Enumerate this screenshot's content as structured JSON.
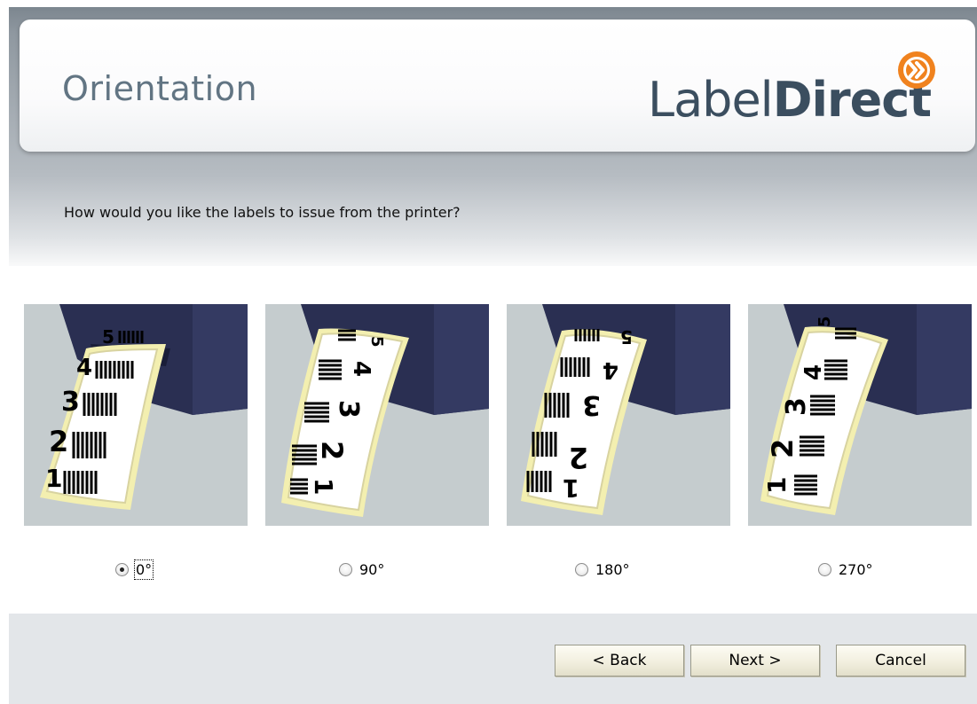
{
  "header": {
    "title": "Orientation",
    "logo": {
      "light": "Label",
      "bold": "Direct",
      "badge_icon": "double-chevron-right-icon"
    }
  },
  "question": "How would you like the labels to issue from the printer?",
  "options": [
    {
      "label": "0°",
      "selected": true,
      "labels_shown": [
        "5",
        "4",
        "3",
        "2",
        "1"
      ]
    },
    {
      "label": "90°",
      "selected": false,
      "labels_shown": [
        "5",
        "4",
        "3",
        "2",
        "1"
      ]
    },
    {
      "label": "180°",
      "selected": false,
      "labels_shown": [
        "5",
        "4",
        "3",
        "2",
        "1"
      ]
    },
    {
      "label": "270°",
      "selected": false,
      "labels_shown": [
        "5",
        "4",
        "3",
        "2",
        "1"
      ]
    }
  ],
  "buttons": {
    "back": "< Back",
    "next": "Next >",
    "cancel": "Cancel"
  },
  "colors": {
    "title": "#627583",
    "logo": "#3b4e5f",
    "badge": "#f0821e",
    "printer": "#2a2f52",
    "label_edge": "#f3efb0"
  }
}
